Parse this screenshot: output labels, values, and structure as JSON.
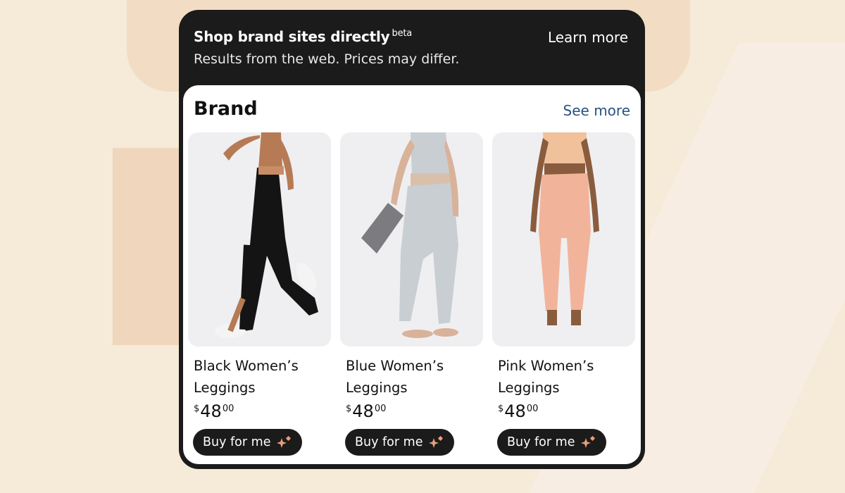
{
  "header": {
    "title": "Shop brand sites directly",
    "beta": "beta",
    "learn_more": "Learn more",
    "subtitle": "Results from the web. Prices may differ."
  },
  "section": {
    "title": "Brand",
    "see_more": "See more"
  },
  "products": [
    {
      "name": "Black Women’s Leggings",
      "currency": "$",
      "price_whole": "48",
      "price_cents": "00",
      "buy_label": "Buy for me",
      "legging_color": "#141414",
      "top_color": "#c98d66"
    },
    {
      "name": "Blue Women’s Leggings",
      "currency": "$",
      "price_whole": "48",
      "price_cents": "00",
      "buy_label": "Buy for me",
      "legging_color": "#c9ced3",
      "top_color": "#c9ced3"
    },
    {
      "name": "Pink Women’s Leggings",
      "currency": "$",
      "price_whole": "48",
      "price_cents": "00",
      "buy_label": "Buy for me",
      "legging_color": "#f1b49b",
      "top_color": "#f1c19c"
    }
  ],
  "colors": {
    "card_bg": "#1b1b1b",
    "link_blue": "#2a5283",
    "sparkle": "#e8a07a"
  }
}
